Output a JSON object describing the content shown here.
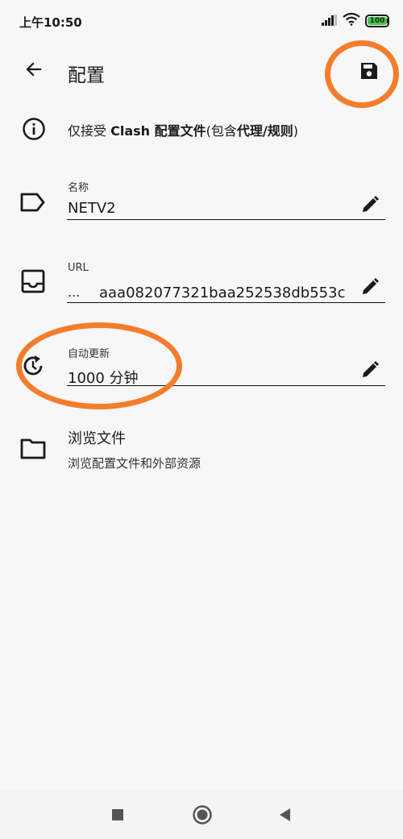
{
  "status_bar": {
    "time": "上午10:50",
    "battery": "100"
  },
  "app_bar": {
    "title": "配置"
  },
  "info": {
    "prefix": "仅接受 ",
    "bold_1": "Clash 配置文件",
    "middle": "(包含",
    "bold_2": "代理/规则",
    "suffix": ")"
  },
  "fields": {
    "name": {
      "label": "名称",
      "value": "NETV2"
    },
    "url": {
      "label": "URL",
      "prefix": "...",
      "value": "aaa082077321baa252538db553c"
    },
    "auto_update": {
      "label": "自动更新",
      "value": "1000 分钟"
    }
  },
  "browse": {
    "title": "浏览文件",
    "subtitle": "浏览配置文件和外部资源"
  },
  "colors": {
    "annotation": "#f47d2c",
    "battery": "#4cc04b"
  }
}
